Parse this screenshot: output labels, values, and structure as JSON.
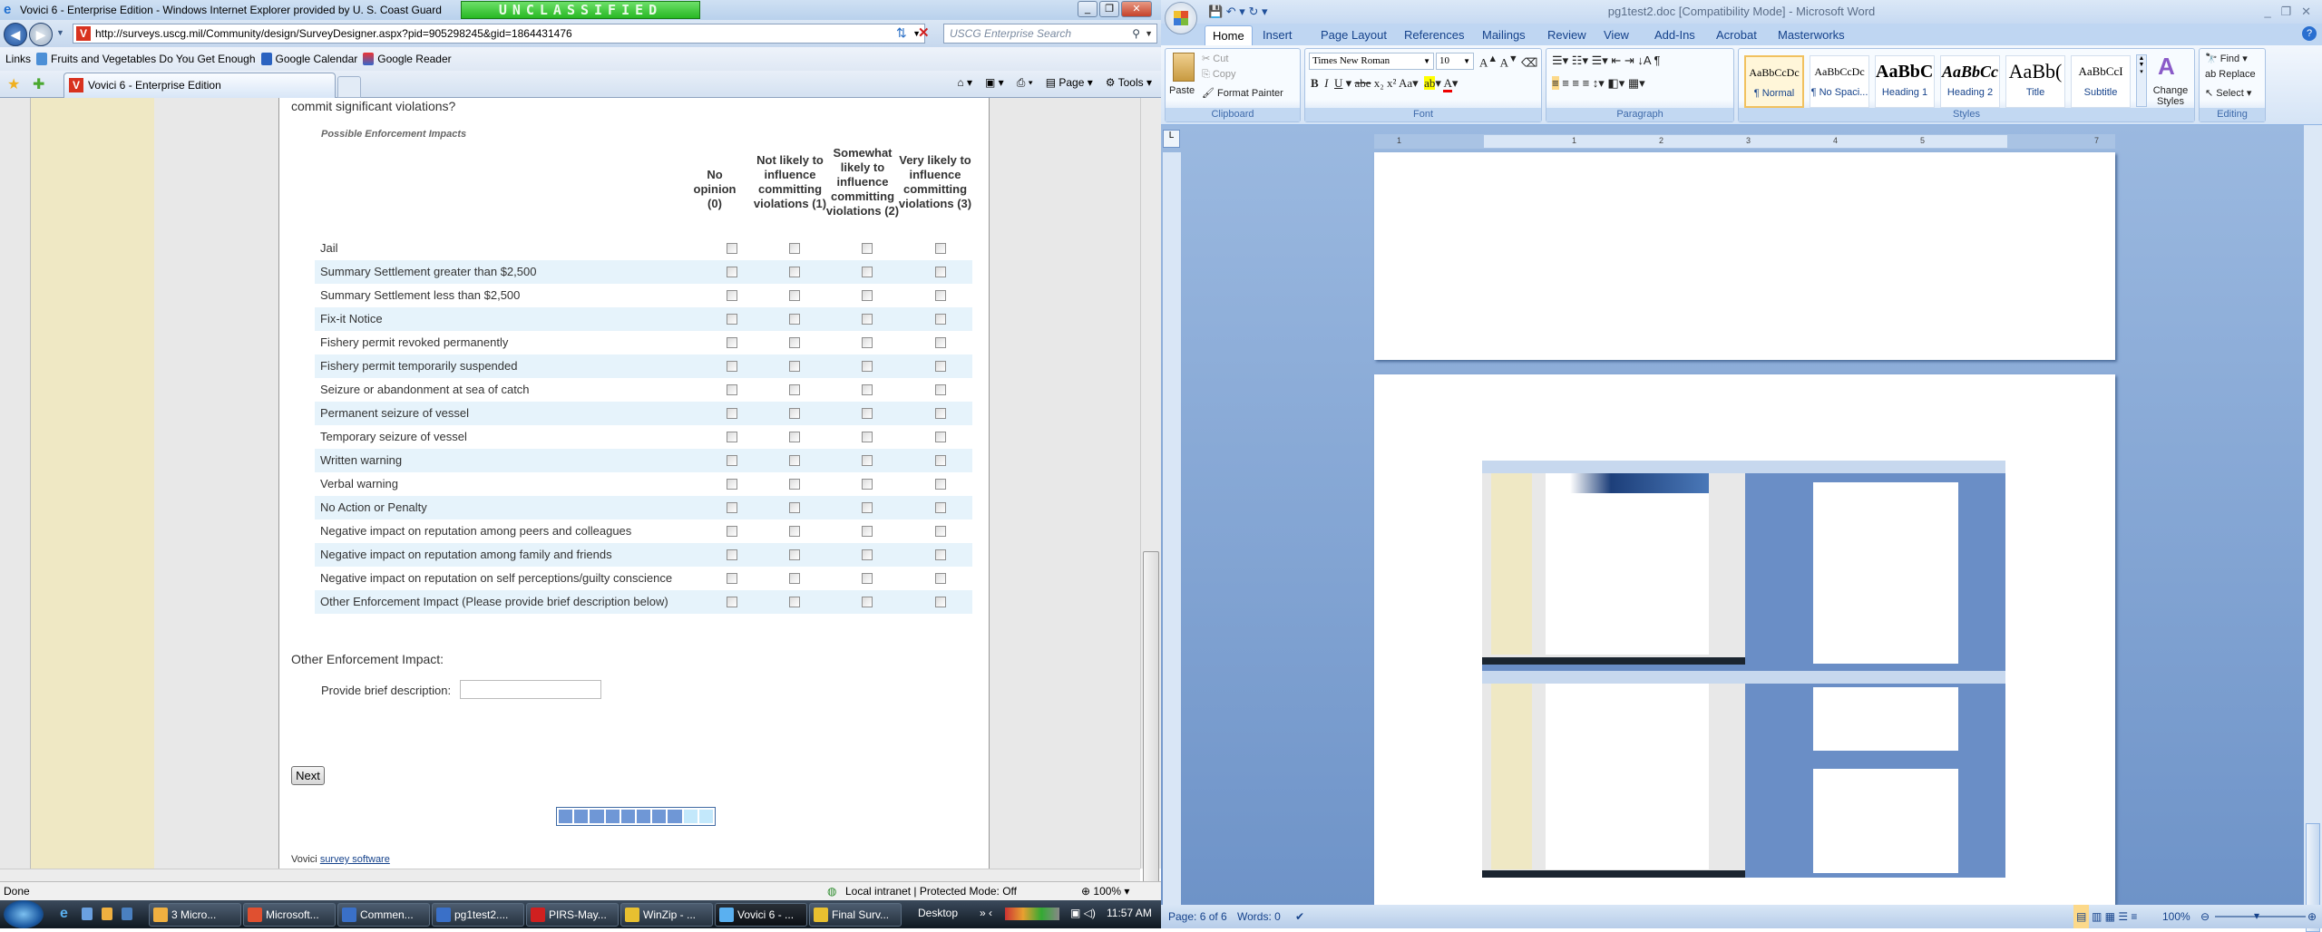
{
  "ie": {
    "title": "Vovici 6 - Enterprise Edition - Windows Internet Explorer provided by U. S. Coast Guard",
    "banner": "UNCLASSIFIED",
    "url": "http://surveys.uscg.mil/Community/design/SurveyDesigner.aspx?pid=905298245&gid=1864431476",
    "search_placeholder": "USCG Enterprise Search",
    "links_label": "Links",
    "links": [
      "Fruits and Vegetables Do You Get Enough",
      "Google Calendar",
      "Google Reader"
    ],
    "tab_title": "Vovici 6 - Enterprise Edition",
    "tools": {
      "page": "Page",
      "tools": "Tools"
    },
    "status": "Done",
    "zone": "Local intranet | Protected Mode: Off",
    "zoom": "100%"
  },
  "survey": {
    "question_tail": "commit significant violations?",
    "section_label": "Possible Enforcement Impacts",
    "columns": [
      "No opinion (0)",
      "Not likely to influence committing violations (1)",
      "Somewhat likely to influence committing violations (2)",
      "Very likely to influence committing violations (3)"
    ],
    "rows": [
      "Jail",
      "Summary Settlement greater than $2,500",
      "Summary Settlement less than $2,500",
      "Fix-it Notice",
      "Fishery permit revoked permanently",
      "Fishery permit temporarily suspended",
      "Seizure or abandonment at sea of catch",
      "Permanent seizure of vessel",
      "Temporary seizure of vessel",
      "Written warning",
      "Verbal warning",
      "No Action or Penalty",
      "Negative impact on reputation among peers and colleagues",
      "Negative impact on reputation among family and friends",
      "Negative impact on reputation on self perceptions/guilty conscience",
      "Other Enforcement Impact (Please provide brief description below)"
    ],
    "other_heading": "Other Enforcement Impact:",
    "desc_label": "Provide brief description:",
    "desc_value": "",
    "next_label": "Next",
    "progress": {
      "completed": 8,
      "total": 10
    },
    "footer_prefix": "Vovici",
    "footer_link": "survey software"
  },
  "taskbar": {
    "items": [
      "3 Micro...",
      "Microsoft...",
      "Commen...",
      "pg1test2....",
      "PIRS-May...",
      "WinZip - ...",
      "Vovici 6 - ...",
      "Final Surv..."
    ],
    "desktop": "Desktop",
    "clock": "11:57 AM"
  },
  "word": {
    "title": "pg1test2.doc [Compatibility Mode] - Microsoft Word",
    "tabs": [
      "Home",
      "Insert",
      "Page Layout",
      "References",
      "Mailings",
      "Review",
      "View",
      "Add-Ins",
      "Acrobat",
      "Masterworks"
    ],
    "clipboard": {
      "paste": "Paste",
      "cut": "Cut",
      "copy": "Copy",
      "format_painter": "Format Painter",
      "label": "Clipboard"
    },
    "font": {
      "name": "Times New Roman",
      "size": "10",
      "label": "Font"
    },
    "paragraph_label": "Paragraph",
    "styles": [
      {
        "preview": "AaBbCcDc",
        "name": "¶ Normal"
      },
      {
        "preview": "AaBbCcDc",
        "name": "¶ No Spaci..."
      },
      {
        "preview": "AaBbC(",
        "name": "Heading 1"
      },
      {
        "preview": "AaBbCc",
        "name": "Heading 2"
      },
      {
        "preview": "AaBb(",
        "name": "Title"
      },
      {
        "preview": "AaBbCcI",
        "name": "Subtitle"
      }
    ],
    "change_styles": "Change Styles",
    "styles_label": "Styles",
    "editing": {
      "find": "Find",
      "replace": "Replace",
      "select": "Select",
      "label": "Editing"
    },
    "ruler": [
      "1",
      "1",
      "2",
      "3",
      "4",
      "5",
      "7"
    ],
    "status": {
      "page": "Page: 6 of 6",
      "words": "Words: 0",
      "zoom": "100%"
    }
  },
  "colors": {
    "row_alt": "#e6f3fb",
    "progress_done": "#6f97d6",
    "progress_todo": "#c3e8fb",
    "word_bg": "#6e93c8"
  }
}
